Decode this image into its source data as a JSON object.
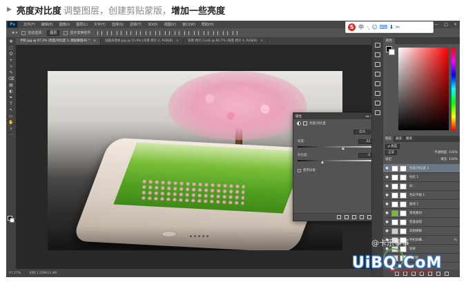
{
  "caption": {
    "marker": "▶",
    "part1": "亮度对比度",
    "part2": "调整图层，创建剪贴蒙版，",
    "part3": "增加一些亮度"
  },
  "app": {
    "logo": "Ps",
    "menus": [
      "文件(F)",
      "编辑(E)",
      "图像(I)",
      "图层(L)",
      "文字(Y)",
      "选择(S)",
      "滤镜(T)",
      "3D(D)",
      "视图(V)",
      "窗口(W)",
      "帮助(H)"
    ],
    "window_controls": [
      "—",
      "□",
      "×"
    ]
  },
  "options_bar": {
    "auto_select": "自动选择：",
    "auto_select_value": "图层",
    "show_transform": "显示变换控件"
  },
  "doc_tabs": [
    {
      "label": "手机.jpg @ 97.3% (亮度/对比度 1, 图层蒙版/8) *",
      "close": "×"
    },
    {
      "label": "炫酷背景材.jpg @ 55.9% (背景 拷贝 2, RGB/8)",
      "close": "×"
    },
    {
      "label": "背景 拷贝 2.psb @ 66.7% (背景 拷贝 4, RGB/8)",
      "close": "×"
    }
  ],
  "tools": [
    "✥",
    "⬚",
    "ʘ",
    "⌖",
    "⊹",
    "✎",
    "⌫",
    "▤",
    "◐",
    "✒",
    "T",
    "↖",
    "▭",
    "✋",
    "⌕",
    "⋯"
  ],
  "status": {
    "zoom": "97.27%",
    "doc": "文档:1.20M/11.4M"
  },
  "properties": {
    "header": "属性",
    "header_ctrls": "◂◂  ×",
    "title": "亮度/对比度",
    "auto": "自动",
    "brightness_label": "亮度:",
    "brightness": "33",
    "contrast_label": "对比度:",
    "contrast": "0",
    "legacy": "使用旧版"
  },
  "color_panel": {
    "tab": "颜色"
  },
  "layers_panel": {
    "tabs": [
      "图层",
      "通道",
      "路径"
    ],
    "filter_label": "ρ 类型",
    "blend_mode": "正常",
    "opacity_label": "不透明度: 100%",
    "lock_label": "锁定:",
    "fill_label": "填充: 100%",
    "layers": [
      {
        "name": "亮度/对比度 1",
        "fx": "",
        "thumb": "#ffffff",
        "selected": true
      },
      {
        "name": "色阶 1",
        "fx": "",
        "thumb": "#ffffff",
        "selected": false
      },
      {
        "name": "树...",
        "fx": "",
        "thumb": "#ffffff",
        "selected": false
      },
      {
        "name": "色彩平衡 1",
        "fx": "",
        "thumb": "#ffffff",
        "selected": false
      },
      {
        "name": "曲线 1",
        "fx": "",
        "thumb": "#ffffff",
        "selected": false
      },
      {
        "name": "草地素材",
        "fx": "",
        "thumb": "#78b83a",
        "selected": false
      },
      {
        "name": "智能滤镜",
        "fx": "",
        "thumb": "#ffffff",
        "selected": false
      },
      {
        "name": "高斯模糊",
        "fx": "",
        "thumb": "#cccccc",
        "selected": false
      },
      {
        "name": "手机屏幕...",
        "fx": "fx",
        "thumb": "#dcdcdc",
        "selected": false
      },
      {
        "name": "效果",
        "fx": "",
        "thumb": "#dcdcdc",
        "selected": false
      },
      {
        "name": "内阴影",
        "fx": "",
        "thumb": "#dcdcdc",
        "selected": false
      }
    ]
  },
  "watermarks": {
    "w1": "@卡乐筝筝",
    "w2": "UiBQ.CoM",
    "w3": "www.psahz.com"
  },
  "overlay": {
    "logo": "S",
    "lang": "中",
    "icons": "·,  ☺  ⌨  ⬇  ✂"
  }
}
